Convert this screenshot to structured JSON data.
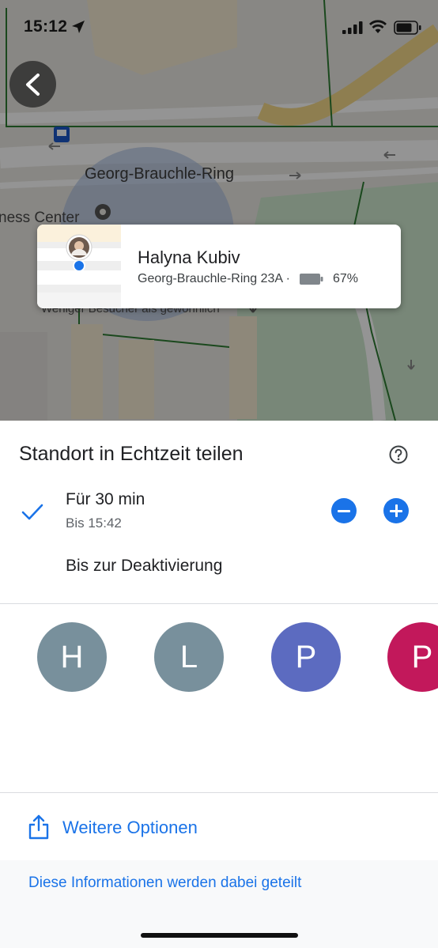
{
  "status_bar": {
    "time": "15:12"
  },
  "map": {
    "street_label": "Georg-Brauchle-Ring",
    "poi_label": "ness Center",
    "crowd_label": "Weniger Besucher als gewöhnlich"
  },
  "person_card": {
    "name": "Halyna Kubiv",
    "address": "Georg-Brauchle-Ring 23A ·",
    "battery": "67%"
  },
  "sheet": {
    "title": "Standort in Echtzeit teilen",
    "duration": {
      "label": "Für 30 min",
      "until": "Bis 15:42"
    },
    "until_off": "Bis zur Deaktivierung",
    "contacts": [
      {
        "initial": "H",
        "color": "#78909c"
      },
      {
        "initial": "L",
        "color": "#78909c"
      },
      {
        "initial": "P",
        "color": "#5c6bc0"
      },
      {
        "initial": "P",
        "color": "#c2185b"
      }
    ],
    "more_options": "Weitere Optionen",
    "info_link": "Diese Informationen werden dabei geteilt"
  },
  "colors": {
    "accent": "#1a73e8"
  }
}
